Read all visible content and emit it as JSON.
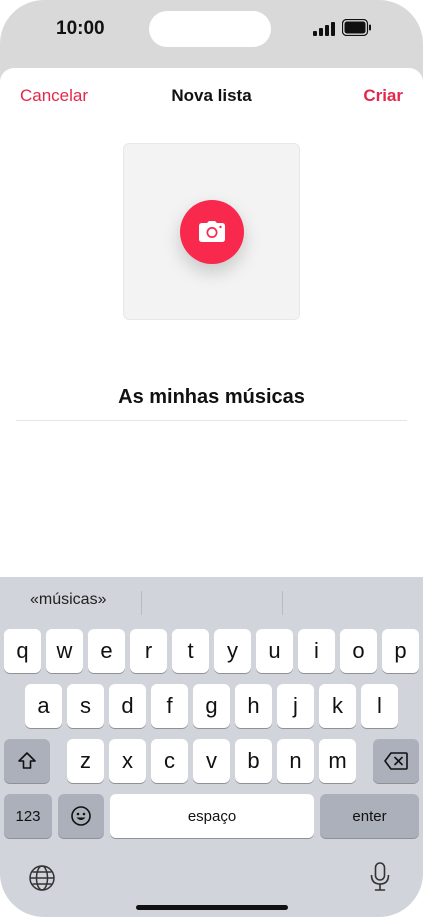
{
  "status_bar": {
    "time": "10:00"
  },
  "nav": {
    "cancel_label": "Cancelar",
    "title": "Nova lista",
    "create_label": "Criar"
  },
  "artwork": {
    "icon": "camera-icon"
  },
  "playlist": {
    "name": "As minhas músicas"
  },
  "keyboard": {
    "suggestions": [
      "«músicas»",
      "",
      ""
    ],
    "row1": [
      "q",
      "w",
      "e",
      "r",
      "t",
      "y",
      "u",
      "i",
      "o",
      "p"
    ],
    "row2": [
      "a",
      "s",
      "d",
      "f",
      "g",
      "h",
      "j",
      "k",
      "l"
    ],
    "row3": [
      "z",
      "x",
      "c",
      "v",
      "b",
      "n",
      "m"
    ],
    "numbers_label": "123",
    "space_label": "espaço",
    "enter_label": "enter",
    "icons": [
      "shift-icon",
      "backspace-icon",
      "emoji-icon",
      "globe-icon",
      "microphone-icon"
    ]
  },
  "colors": {
    "accent": "#e3284b",
    "camera_button": "#f8294d",
    "keyboard_bg": "#d1d4db"
  }
}
